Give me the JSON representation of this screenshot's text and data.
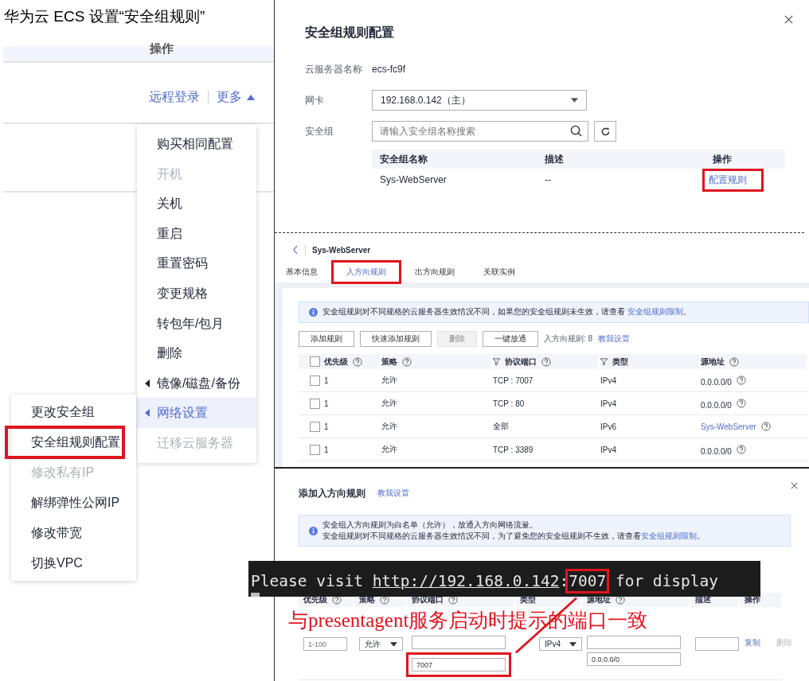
{
  "doc_title": "华为云 ECS 设置“安全组规则”",
  "instance_list": {
    "column_header": "操作",
    "actions": [
      {
        "label": "远程登录",
        "kind": "link"
      },
      {
        "label": "更多",
        "kind": "dropdown",
        "expanded": true
      }
    ],
    "more_menu": [
      {
        "label": "购买相同配置",
        "disabled": false,
        "selected": false,
        "has_submenu": false
      },
      {
        "label": "开机",
        "disabled": true,
        "selected": false,
        "has_submenu": false
      },
      {
        "label": "关机",
        "disabled": false,
        "selected": false,
        "has_submenu": false
      },
      {
        "label": "重启",
        "disabled": false,
        "selected": false,
        "has_submenu": false
      },
      {
        "label": "重置密码",
        "disabled": false,
        "selected": false,
        "has_submenu": false
      },
      {
        "label": "变更规格",
        "disabled": false,
        "selected": false,
        "has_submenu": false
      },
      {
        "label": "转包年/包月",
        "disabled": false,
        "selected": false,
        "has_submenu": false
      },
      {
        "label": "删除",
        "disabled": false,
        "selected": false,
        "has_submenu": false
      },
      {
        "label": "镜像/磁盘/备份",
        "disabled": false,
        "selected": false,
        "has_submenu": true
      },
      {
        "label": "网络设置",
        "disabled": false,
        "selected": true,
        "has_submenu": true
      },
      {
        "label": "迁移云服务器",
        "disabled": true,
        "selected": false,
        "has_submenu": false
      }
    ],
    "submenu": [
      {
        "label": "更改安全组",
        "disabled": false,
        "highlighted": false
      },
      {
        "label": "安全组规则配置",
        "disabled": false,
        "highlighted": true
      },
      {
        "label": "修改私有IP",
        "disabled": true,
        "highlighted": false
      },
      {
        "label": "解绑弹性公网IP",
        "disabled": false,
        "highlighted": false
      },
      {
        "label": "修改带宽",
        "disabled": false,
        "highlighted": false
      },
      {
        "label": "切换VPC",
        "disabled": false,
        "highlighted": false
      }
    ]
  },
  "rule_dialog": {
    "title": "安全组规则配置",
    "server_name": {
      "label": "云服务器名称",
      "value": "ecs-fc9f"
    },
    "nic": {
      "label": "网卡",
      "value": "192.168.0.142（主）"
    },
    "security_group": {
      "label": "安全组",
      "placeholder": "请输入安全组名称搜索"
    },
    "table": {
      "columns": [
        "安全组名称",
        "描述",
        "操作"
      ],
      "rows": [
        {
          "name": "Sys-WebServer",
          "description": "--",
          "action": "配置规则",
          "highlighted": true
        }
      ]
    }
  },
  "group_page": {
    "title": "Sys-WebServer",
    "tabs": [
      {
        "label": "基本信息",
        "selected": false,
        "highlighted": false
      },
      {
        "label": "入方向规则",
        "selected": true,
        "highlighted": true
      },
      {
        "label": "出方向规则",
        "selected": false,
        "highlighted": false
      },
      {
        "label": "关联实例",
        "selected": false,
        "highlighted": false
      }
    ],
    "notice": {
      "text": "安全组规则对不同规格的云服务器生效情况不同，如果您的安全组规则未生效，请查看",
      "link": "安全组规则限制",
      "end": "。"
    },
    "buttons": [
      {
        "label": "添加规则",
        "disabled": false
      },
      {
        "label": "快速添加规则",
        "disabled": false
      },
      {
        "label": "删除",
        "disabled": true
      },
      {
        "label": "一键放通",
        "disabled": false
      }
    ],
    "rule_count": "入方向规则: 8",
    "help_link": "教我设置",
    "table": {
      "select_all_checked": false,
      "columns": [
        {
          "label": "优先级",
          "filter": false,
          "help": true
        },
        {
          "label": "策略",
          "filter": false,
          "help": true
        },
        {
          "label": "协议端口",
          "filter": true,
          "help": true
        },
        {
          "label": "类型",
          "filter": true,
          "help": false
        },
        {
          "label": "源地址",
          "filter": false,
          "help": true
        }
      ],
      "rows": [
        {
          "checked": false,
          "priority": "1",
          "policy": "允许",
          "port": "TCP : 7007",
          "type": "IPv4",
          "source": "0.0.0.0/0",
          "kind": "address"
        },
        {
          "checked": false,
          "priority": "1",
          "policy": "允许",
          "port": "TCP : 80",
          "type": "IPv4",
          "source": "0.0.0.0/0",
          "kind": "address"
        },
        {
          "checked": false,
          "priority": "1",
          "policy": "允许",
          "port": "全部",
          "type": "IPv6",
          "source": "Sys-WebServer",
          "kind": "group"
        },
        {
          "checked": false,
          "priority": "1",
          "policy": "允许",
          "port": "TCP : 3389",
          "type": "IPv4",
          "source": "0.0.0.0/0",
          "kind": "address"
        }
      ]
    }
  },
  "add_dialog": {
    "title": "添加入方向规则",
    "help_link": "教我设置",
    "notice": {
      "line_1": "安全组入方向规则为白名单（允许），放通入方向网络流量。",
      "line_2": "安全组规则对不同规格的云服务器生效情况不同，为了避免您的安全组规则不生效，请查看",
      "link": "安全组规则限制",
      "end": "。"
    },
    "columns": [
      {
        "label": "优先级",
        "help": true
      },
      {
        "label": "策略",
        "help": true
      },
      {
        "label": "协议端口",
        "help": true
      },
      {
        "label": "类型",
        "help": false
      },
      {
        "label": "源地址",
        "help": true
      },
      {
        "label": "描述",
        "help": false
      },
      {
        "label": "操作",
        "help": false
      }
    ],
    "form": {
      "priority_placeholder": "1-100",
      "policy": "允许",
      "port": "7007",
      "port_highlighted": true,
      "type": "IPv4",
      "source": "0.0.0.0/0",
      "actions": [
        {
          "label": "复制",
          "disabled": false
        },
        {
          "label": "删除",
          "disabled": true
        }
      ]
    }
  },
  "terminal": {
    "before": "Please visit ",
    "url": "http://192.168.0.142",
    "colon": ":",
    "port": "7007",
    "port_highlighted": true,
    "after": " for display"
  },
  "annotation": {
    "text": "与presentagent服务启动时提示的端口一致"
  }
}
